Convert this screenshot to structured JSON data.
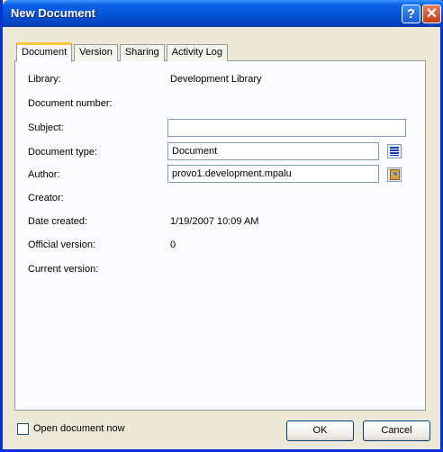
{
  "window": {
    "title": "New Document"
  },
  "titlebar": {
    "help_label": "?",
    "close_label": "✕"
  },
  "tabs": [
    {
      "label": "Document",
      "active": true
    },
    {
      "label": "Version",
      "active": false
    },
    {
      "label": "Sharing",
      "active": false
    },
    {
      "label": "Activity Log",
      "active": false
    }
  ],
  "fields": {
    "library": {
      "label": "Library:",
      "value": "Development Library"
    },
    "document_number": {
      "label": "Document number:",
      "value": ""
    },
    "subject": {
      "label": "Subject:",
      "value": ""
    },
    "document_type": {
      "label": "Document type:",
      "value": "Document"
    },
    "author": {
      "label": "Author:",
      "value": "provo1.development.mpalu"
    },
    "creator": {
      "label": "Creator:",
      "value": ""
    },
    "date_created": {
      "label": "Date created:",
      "value": "1/19/2007 10:09 AM"
    },
    "official_version": {
      "label": "Official version:",
      "value": "0"
    },
    "current_version": {
      "label": "Current version:",
      "value": ""
    }
  },
  "icons": {
    "document_type_picker": "list-icon",
    "author_picker": "address-book-icon"
  },
  "footer": {
    "open_now_label": "Open document now",
    "open_now_checked": false,
    "ok_label": "OK",
    "cancel_label": "Cancel"
  },
  "colors": {
    "titlebar": "#0455d6",
    "active_tab_accent": "#ffc83c",
    "dialog_background": "#ece9d8"
  }
}
